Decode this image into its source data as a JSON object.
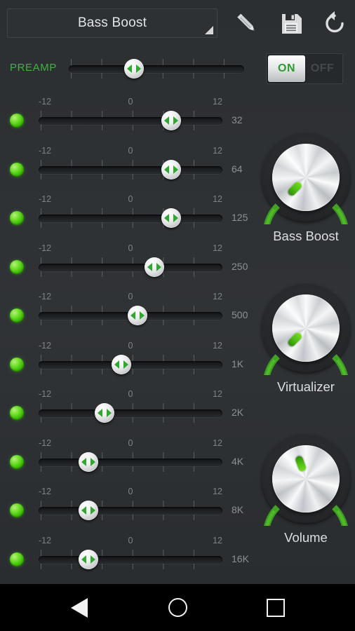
{
  "app": {
    "background": "#2f3235",
    "accent_green": "#3fb23f",
    "led_green": "#4fd41a"
  },
  "toolbar": {
    "preset_name": "Bass Boost",
    "spinner_caret_icon": "dropdown-triangle-icon",
    "actions": [
      {
        "name": "edit-preset-button",
        "icon": "pencil-icon",
        "label": "Edit"
      },
      {
        "name": "save-preset-button",
        "icon": "floppy-disk-icon",
        "label": "Save"
      },
      {
        "name": "reset-preset-button",
        "icon": "reset-arrow-icon",
        "label": "Reset"
      }
    ]
  },
  "preamp": {
    "label": "PREAMP",
    "handle_percent": 37
  },
  "power": {
    "on_label": "ON",
    "off_label": "OFF",
    "state": "ON"
  },
  "scale": {
    "min": "-12",
    "mid": "0",
    "max": "12"
  },
  "bands": [
    {
      "freq": "32",
      "handle_percent": 72
    },
    {
      "freq": "64",
      "handle_percent": 72
    },
    {
      "freq": "125",
      "handle_percent": 72
    },
    {
      "freq": "250",
      "handle_percent": 63
    },
    {
      "freq": "500",
      "handle_percent": 54
    },
    {
      "freq": "1K",
      "handle_percent": 45
    },
    {
      "freq": "2K",
      "handle_percent": 36
    },
    {
      "freq": "4K",
      "handle_percent": 27
    },
    {
      "freq": "8K",
      "handle_percent": 27
    },
    {
      "freq": "16K",
      "handle_percent": 27
    }
  ],
  "knobs": [
    {
      "label": "Bass Boost",
      "angle_deg": 225
    },
    {
      "label": "Virtualizer",
      "angle_deg": 225
    },
    {
      "label": "Volume",
      "angle_deg": 340
    }
  ],
  "navbar": {
    "back_icon": "back-triangle-icon",
    "home_icon": "home-circle-icon",
    "recents_icon": "recents-square-icon"
  }
}
